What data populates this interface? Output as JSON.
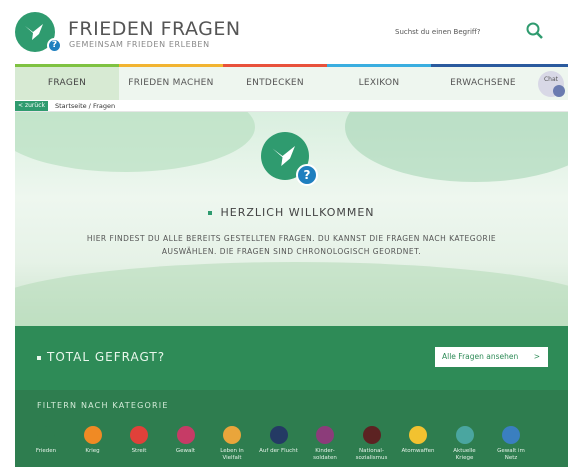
{
  "header": {
    "brand_title": "FRIEDEN FRAGEN",
    "brand_subtitle": "GEMEINSAM FRIEDEN ERLEBEN",
    "logo_badge": "?",
    "search_placeholder": "Suchst du einen Begriff?"
  },
  "nav": {
    "items": [
      {
        "label": "FRAGEN",
        "active": true,
        "color": "#7fc241"
      },
      {
        "label": "FRIEDEN MACHEN",
        "active": false,
        "color": "#f2b431"
      },
      {
        "label": "ENTDECKEN",
        "active": false,
        "color": "#e8513b"
      },
      {
        "label": "LEXIKON",
        "active": false,
        "color": "#3aaee0"
      },
      {
        "label": "ERWACHSENE",
        "active": false,
        "color": "#2a5a9e"
      }
    ],
    "chat_label": "Chat"
  },
  "breadcrumb": {
    "back_label": "< zurück",
    "path": "Startseite / Fragen"
  },
  "hero": {
    "badge": "?",
    "welcome": "HERZLICH WILLKOMMEN",
    "intro": "HIER FINDEST DU ALLE BEREITS GESTELLTEN FRAGEN. DU KANNST DIE FRAGEN NACH KATEGORIE AUSWÄHLEN. DIE FRAGEN SIND CHRONOLOGISCH GEORDNET."
  },
  "total": {
    "title": "TOTAL GEFRAGT?",
    "button_label": "Alle Fragen ansehen",
    "button_chevron": ">"
  },
  "filter": {
    "title": "FILTERN NACH KATEGORIE",
    "categories": [
      {
        "label": "Frieden",
        "icon": "dove-icon",
        "color": "#2e7d4f"
      },
      {
        "label": "Krieg",
        "icon": "fire-icon",
        "color": "#f08a24"
      },
      {
        "label": "Streit",
        "icon": "fist-icon",
        "color": "#e0413a"
      },
      {
        "label": "Gewalt",
        "icon": "hand-icon",
        "color": "#c63b66"
      },
      {
        "label": "Leben in Vielfalt",
        "icon": "rainbow-icon",
        "color": "#e9a53b"
      },
      {
        "label": "Auf der Flucht",
        "icon": "boat-icon",
        "color": "#243a64"
      },
      {
        "label": "Kinder-soldaten",
        "icon": "helmet-icon",
        "color": "#8c3c7a"
      },
      {
        "label": "National-sozialismus",
        "icon": "stop-icon",
        "color": "#5c2222"
      },
      {
        "label": "Atomwaffen",
        "icon": "radiation-icon",
        "color": "#f2c230"
      },
      {
        "label": "Aktuelle Kriege",
        "icon": "globe-icon",
        "color": "#4aa6a0"
      },
      {
        "label": "Gewalt im Netz",
        "icon": "laptop-icon",
        "color": "#3a7fc0"
      }
    ]
  }
}
